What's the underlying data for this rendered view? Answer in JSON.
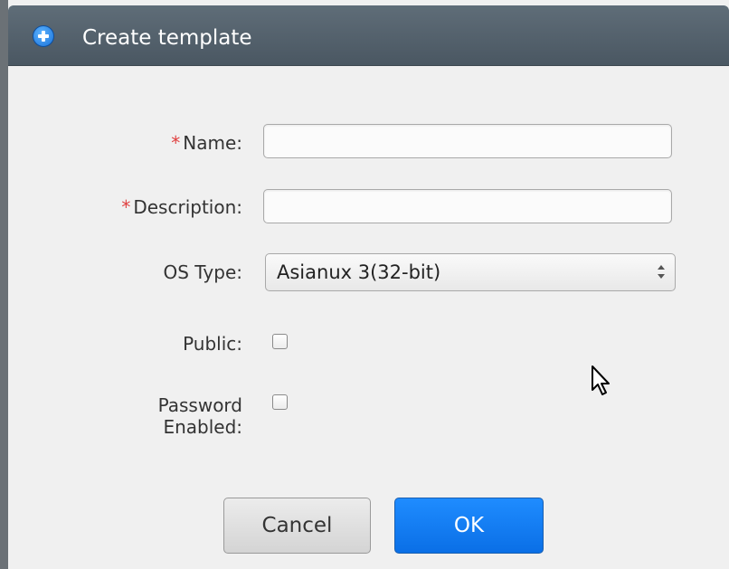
{
  "dialog": {
    "title": "Create template",
    "title_icon": "plus-circle-icon"
  },
  "form": {
    "name": {
      "required": "*",
      "label": "Name:",
      "value": ""
    },
    "description": {
      "required": "*",
      "label": "Description:",
      "value": ""
    },
    "os_type": {
      "label": "OS Type:",
      "selected": "Asianux 3(32-bit)"
    },
    "public": {
      "label": "Public:",
      "checked": false
    },
    "password_enabled": {
      "label_line1": "Password",
      "label_line2": "Enabled:",
      "checked": false
    }
  },
  "buttons": {
    "cancel_label": "Cancel",
    "ok_label": "OK"
  },
  "colors": {
    "titlebar": "#4f5c67",
    "ok_button": "#1a7ff0",
    "required_asterisk": "#e04040"
  }
}
